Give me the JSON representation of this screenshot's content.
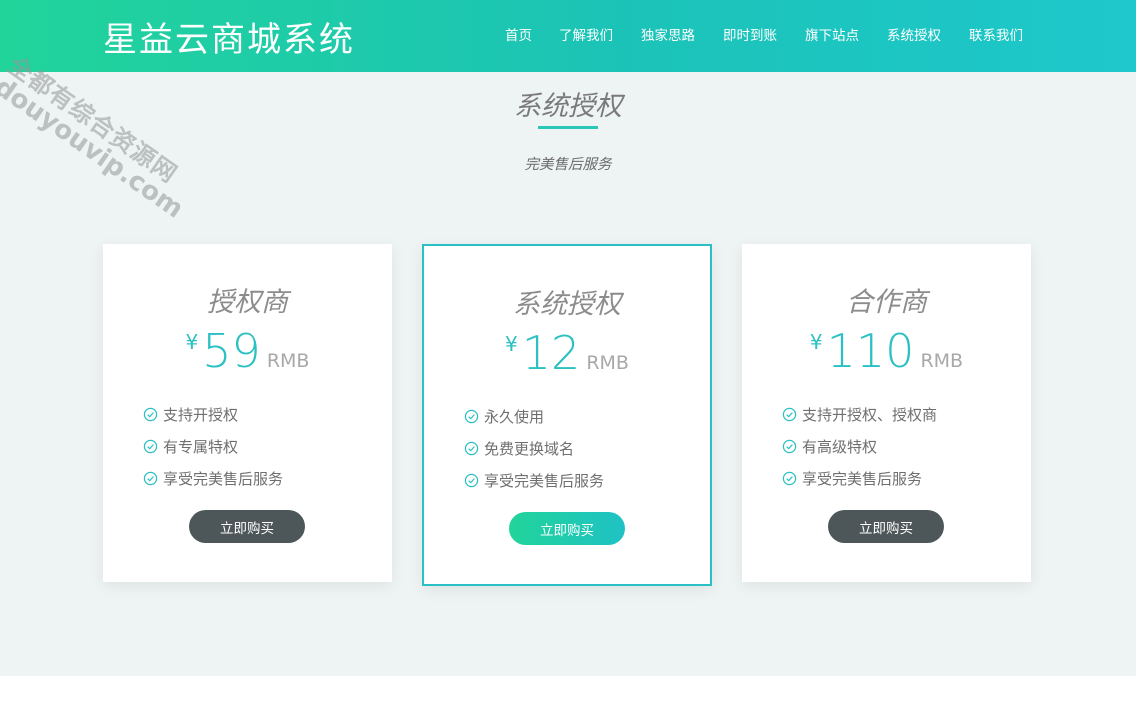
{
  "header": {
    "logo": "星益云商城系统",
    "nav": [
      "首页",
      "了解我们",
      "独家思路",
      "即时到账",
      "旗下站点",
      "系统授权",
      "联系我们"
    ]
  },
  "section": {
    "title": "系统授权",
    "subtitle": "完美售后服务"
  },
  "plans": [
    {
      "name": "授权商",
      "currency": "¥",
      "price": "59",
      "unit": "RMB",
      "features": [
        "支持开授权",
        "有专属特权",
        "享受完美售后服务"
      ],
      "button": "立即购买"
    },
    {
      "name": "系统授权",
      "currency": "¥",
      "price": "12",
      "unit": "RMB",
      "features": [
        "永久使用",
        "免费更换域名",
        "享受完美售后服务"
      ],
      "button": "立即购买"
    },
    {
      "name": "合作商",
      "currency": "¥",
      "price": "110",
      "unit": "RMB",
      "features": [
        "支持开授权、授权商",
        "有高级特权",
        "享受完美售后服务"
      ],
      "button": "立即购买"
    }
  ],
  "watermark": {
    "line1": "全都有综合资源网",
    "line2": "douyouvip.com"
  },
  "colors": {
    "accent": "#2bc0c2",
    "header_start": "#21d49a",
    "header_end": "#1ec8cc",
    "button_dark": "#4d5759"
  }
}
